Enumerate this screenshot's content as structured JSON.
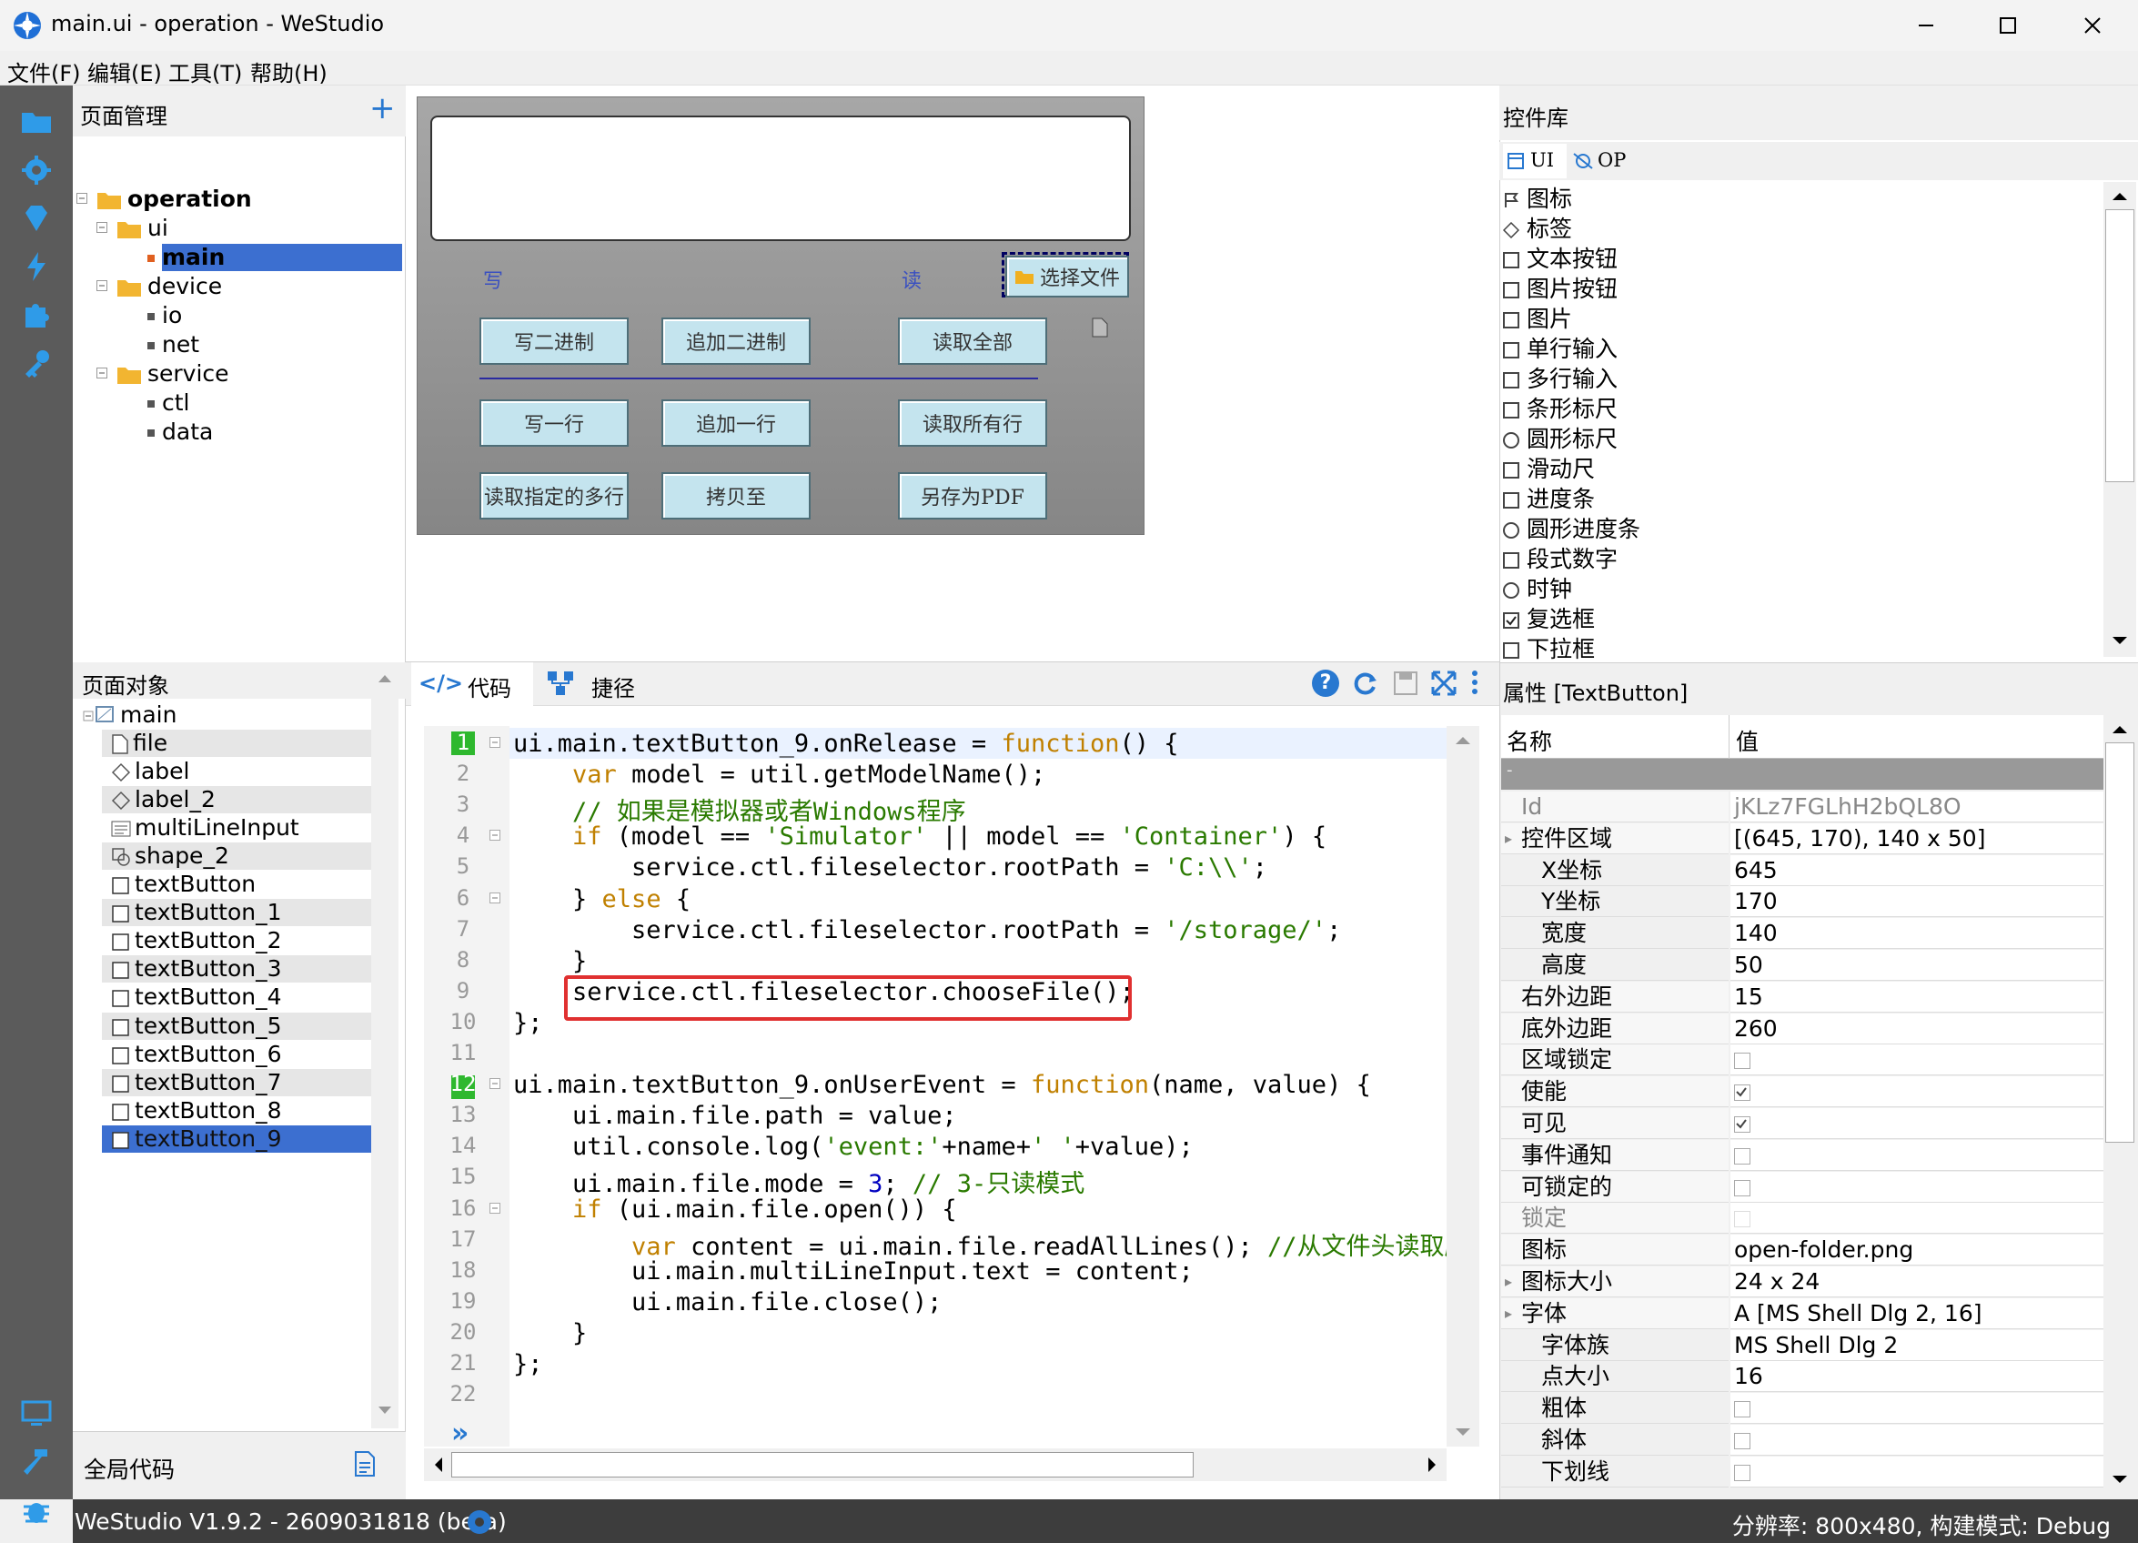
{
  "window": {
    "title": "main.ui - operation - WeStudio"
  },
  "menu": [
    "文件(F)",
    "编辑(E)",
    "工具(T)",
    "帮助(H)"
  ],
  "page_manager": {
    "title": "页面管理",
    "tree": [
      {
        "label": "operation",
        "depth": 0,
        "type": "folder",
        "bold": true
      },
      {
        "label": "ui",
        "depth": 1,
        "type": "folder"
      },
      {
        "label": "main",
        "depth": 2,
        "type": "item",
        "selected": true,
        "bold": true
      },
      {
        "label": "device",
        "depth": 1,
        "type": "folder"
      },
      {
        "label": "io",
        "depth": 2,
        "type": "item"
      },
      {
        "label": "net",
        "depth": 2,
        "type": "item"
      },
      {
        "label": "service",
        "depth": 1,
        "type": "folder"
      },
      {
        "label": "ctl",
        "depth": 2,
        "type": "item"
      },
      {
        "label": "data",
        "depth": 2,
        "type": "item"
      }
    ]
  },
  "page_objects": {
    "title": "页面对象",
    "root": "main",
    "items": [
      "file",
      "label",
      "label_2",
      "multiLineInput",
      "shape_2",
      "textButton",
      "textButton_1",
      "textButton_2",
      "textButton_3",
      "textButton_4",
      "textButton_5",
      "textButton_6",
      "textButton_7",
      "textButton_8",
      "textButton_9"
    ],
    "selected": "textButton_9"
  },
  "global_code": {
    "label": "全局代码"
  },
  "designer": {
    "label_write": "写",
    "label_read": "读",
    "file_button": "选择文件",
    "buttons": [
      "写二进制",
      "追加二进制",
      "读取全部",
      "写一行",
      "追加一行",
      "读取所有行",
      "读取指定的多行",
      "拷贝至",
      "另存为PDF"
    ]
  },
  "editor": {
    "tab_code": "代码",
    "tab_path": "捷径",
    "line_numbers": [
      "1",
      "2",
      "3",
      "4",
      "5",
      "6",
      "7",
      "8",
      "9",
      "10",
      "11",
      "12",
      "13",
      "14",
      "15",
      "16",
      "17",
      "18",
      "19",
      "20",
      "21",
      "22"
    ],
    "lines": [
      [
        [
          "ui.main.textButton_9.onRelease = ",
          ""
        ],
        [
          "function",
          "kw"
        ],
        [
          "() {",
          ""
        ]
      ],
      [
        [
          "    ",
          ""
        ],
        [
          "var",
          "kw"
        ],
        [
          " model = util.getModelName();",
          ""
        ]
      ],
      [
        [
          "    ",
          ""
        ],
        [
          "// 如果是模拟器或者Windows程序",
          "cmt"
        ]
      ],
      [
        [
          "    ",
          ""
        ],
        [
          "if",
          "kw"
        ],
        [
          " (model == ",
          ""
        ],
        [
          "'Simulator'",
          "str"
        ],
        [
          " || model == ",
          ""
        ],
        [
          "'Container'",
          "str"
        ],
        [
          ") {",
          ""
        ]
      ],
      [
        [
          "        service.ctl.fileselector.rootPath = ",
          ""
        ],
        [
          "'C:\\\\'",
          "str"
        ],
        [
          ";",
          ""
        ]
      ],
      [
        [
          "    } ",
          ""
        ],
        [
          "else",
          "kw"
        ],
        [
          " {",
          ""
        ]
      ],
      [
        [
          "        service.ctl.fileselector.rootPath = ",
          ""
        ],
        [
          "'/storage/'",
          "str"
        ],
        [
          ";",
          ""
        ]
      ],
      [
        [
          "    }",
          ""
        ]
      ],
      [
        [
          "    service.ctl.fileselector.chooseFile();",
          ""
        ]
      ],
      [
        [
          "};",
          ""
        ]
      ],
      [
        [
          "",
          ""
        ]
      ],
      [
        [
          "ui.main.textButton_9.onUserEvent = ",
          ""
        ],
        [
          "function",
          "kw"
        ],
        [
          "(name, value) {",
          ""
        ]
      ],
      [
        [
          "    ui.main.file.path = value;",
          ""
        ]
      ],
      [
        [
          "    util.console.log(",
          ""
        ],
        [
          "'event:'",
          "str"
        ],
        [
          "+name+",
          ""
        ],
        [
          "' '",
          "str"
        ],
        [
          "+value);",
          ""
        ]
      ],
      [
        [
          "    ui.main.file.mode = ",
          ""
        ],
        [
          "3",
          "num"
        ],
        [
          "; ",
          ""
        ],
        [
          "// 3-只读模式",
          "cmt"
        ]
      ],
      [
        [
          "    ",
          ""
        ],
        [
          "if",
          "kw"
        ],
        [
          " (ui.main.file.open()) {",
          ""
        ]
      ],
      [
        [
          "        ",
          ""
        ],
        [
          "var",
          "kw"
        ],
        [
          " content = ui.main.file.readAllLines(); ",
          ""
        ],
        [
          "//从文件头读取所",
          "cmt"
        ]
      ],
      [
        [
          "        ui.main.multiLineInput.text = content;",
          ""
        ]
      ],
      [
        [
          "        ui.main.file.close();",
          ""
        ]
      ],
      [
        [
          "    }",
          ""
        ]
      ],
      [
        [
          "};",
          ""
        ]
      ],
      [
        [
          "",
          ""
        ]
      ]
    ]
  },
  "widget_library": {
    "title": "控件库",
    "tab_ui": "UI",
    "tab_op": "OP",
    "items": [
      "图标",
      "标签",
      "文本按钮",
      "图片按钮",
      "图片",
      "单行输入",
      "多行输入",
      "条形标尺",
      "圆形标尺",
      "滑动尺",
      "进度条",
      "圆形进度条",
      "段式数字",
      "时钟",
      "复选框",
      "下拉框"
    ]
  },
  "properties": {
    "title": "属性 [TextButton]",
    "col_name": "名称",
    "col_value": "值",
    "rows": [
      {
        "name": "Id",
        "value": "jKLz7FGLhH2bQL8O",
        "disabled": true
      },
      {
        "name": "控件区域",
        "value": "[(645, 170), 140 x 50]",
        "group": true
      },
      {
        "name": "X坐标",
        "value": "645",
        "sub": true
      },
      {
        "name": "Y坐标",
        "value": "170",
        "sub": true
      },
      {
        "name": "宽度",
        "value": "140",
        "sub": true
      },
      {
        "name": "高度",
        "value": "50",
        "sub": true
      },
      {
        "name": "右外边距",
        "value": "15"
      },
      {
        "name": "底外边距",
        "value": "260"
      },
      {
        "name": "区域锁定",
        "check": true
      },
      {
        "name": "使能",
        "check": true,
        "checked": true
      },
      {
        "name": "可见",
        "check": true,
        "checked": true
      },
      {
        "name": "事件通知",
        "check": true
      },
      {
        "name": "可锁定的",
        "check": true
      },
      {
        "name": "锁定",
        "check": true,
        "disabled": true
      },
      {
        "name": "图标",
        "value": "open-folder.png"
      },
      {
        "name": "图标大小",
        "value": "24 x 24",
        "group": true
      },
      {
        "name": "字体",
        "value": "A [MS Shell Dlg 2, 16]",
        "group": true
      },
      {
        "name": "字体族",
        "value": "MS Shell Dlg 2",
        "sub": true
      },
      {
        "name": "点大小",
        "value": "16",
        "sub": true
      },
      {
        "name": "粗体",
        "check": true,
        "sub": true
      },
      {
        "name": "斜体",
        "check": true,
        "sub": true
      },
      {
        "name": "下划线",
        "check": true,
        "sub": true
      }
    ]
  },
  "status": {
    "left": "WeStudio V1.9.2 - 2609031818 (beta)",
    "right": "分辨率: 800x480, 构建模式: Debug"
  },
  "colors": {
    "accent": "#2878d0",
    "selection": "#3c6fd0",
    "highlight_box": "#e03030",
    "activity_bar": "#5b5b5b"
  }
}
